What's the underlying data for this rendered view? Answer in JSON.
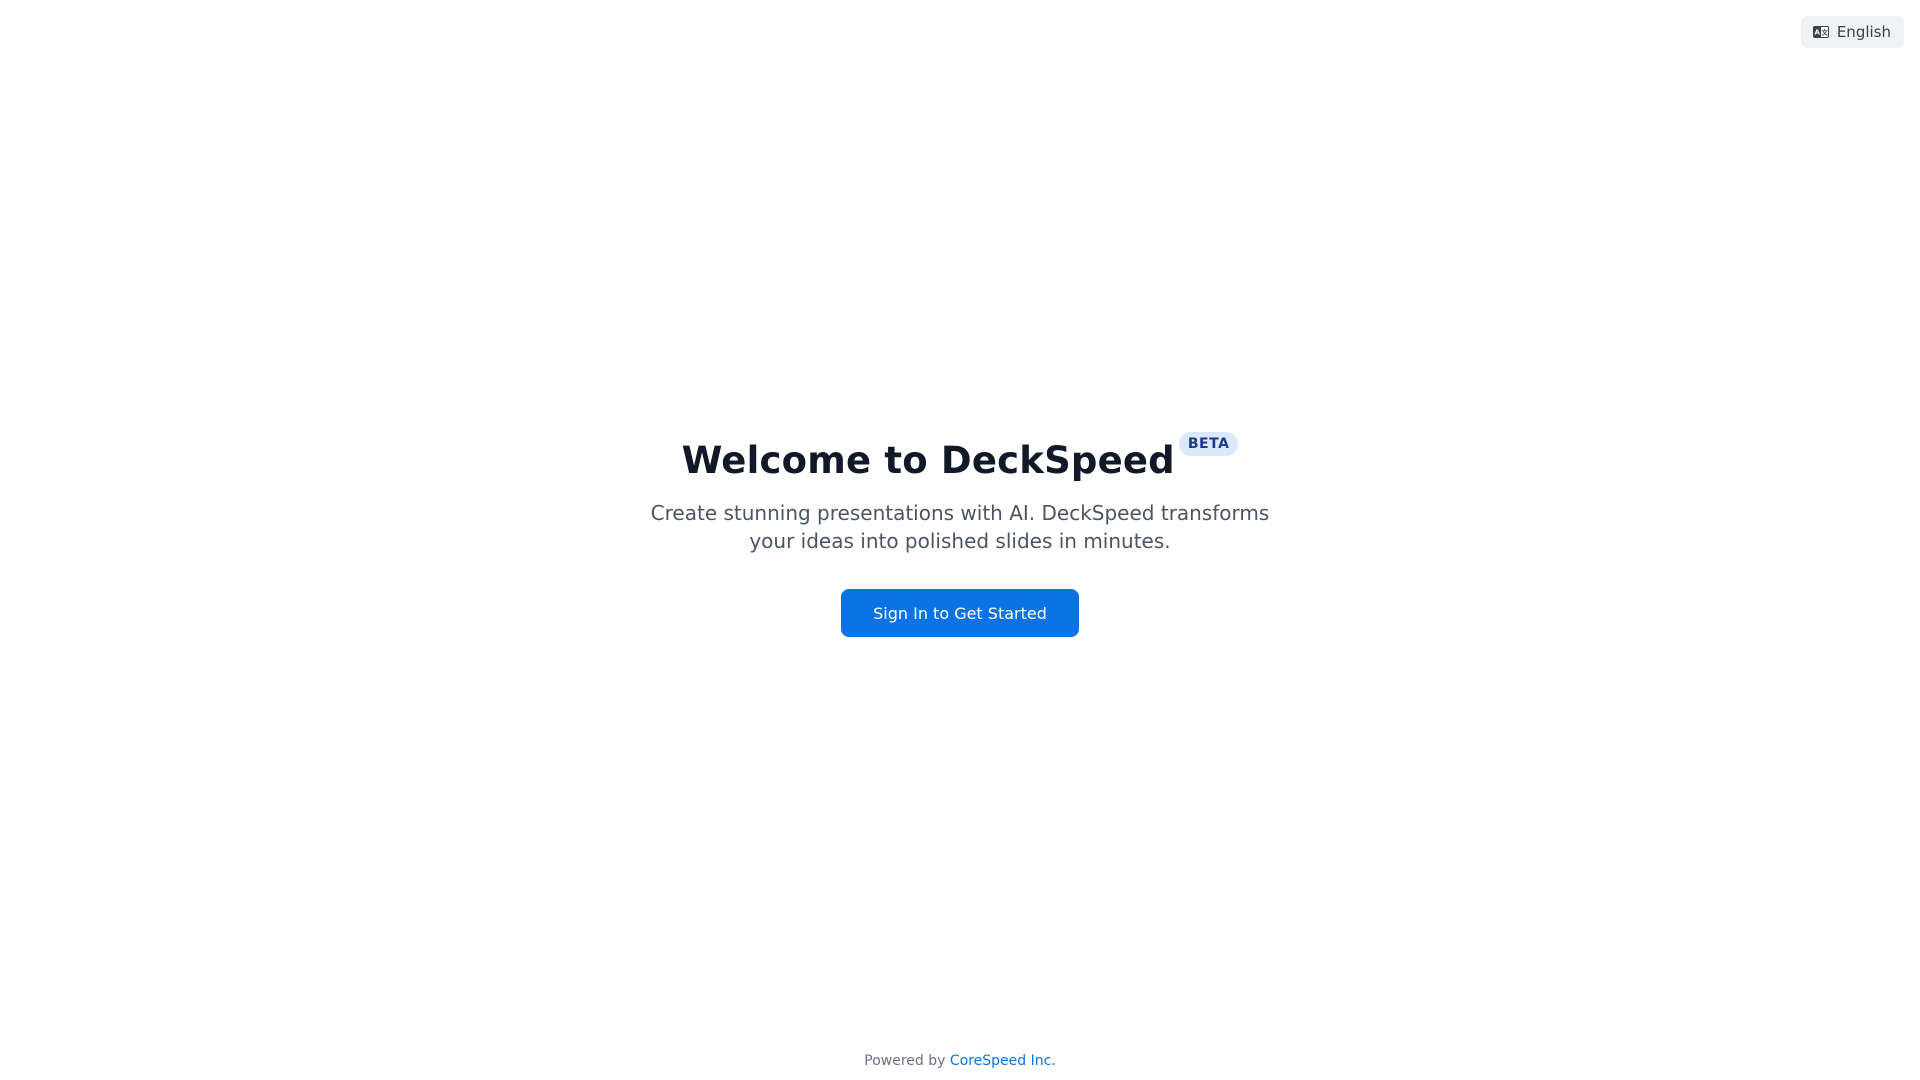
{
  "language_selector": {
    "icon": "language-icon",
    "label": "English"
  },
  "hero": {
    "title": "Welcome to DeckSpeed",
    "badge": "BETA",
    "subtitle_line1": "Create stunning presentations with AI. DeckSpeed transforms",
    "subtitle_line2": "your ideas into polished slides in minutes.",
    "cta_label": "Sign In to Get Started"
  },
  "footer": {
    "prefix": "Powered by",
    "link_text": "CoreSpeed Inc."
  },
  "colors": {
    "accent": "#0b73e6",
    "title": "#111827",
    "badge_bg": "#dbe7fb",
    "badge_text": "#1e3a8a"
  }
}
